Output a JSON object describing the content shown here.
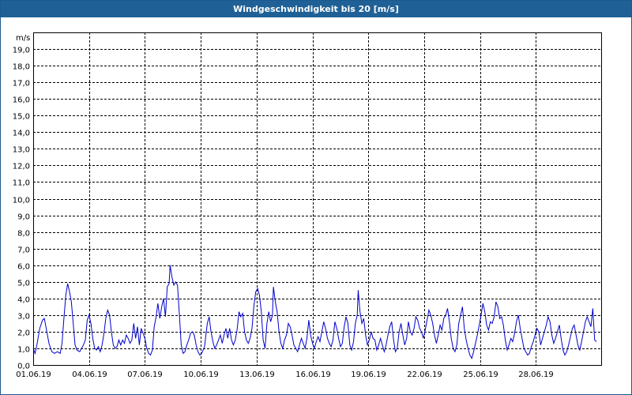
{
  "window": {
    "title": "Windgeschwindigkeit bis 20 [m/s]"
  },
  "colors": {
    "titlebar": "#1f6196",
    "series": "#0000cc",
    "grid": "#000000"
  },
  "chart_data": {
    "type": "line",
    "title": "Windgeschwindigkeit bis 20 [m/s]",
    "ylabel": "m/s",
    "xlabel": "",
    "ylim": [
      0,
      20
    ],
    "grid": true,
    "y_ticks": [
      "0,0",
      "1,0",
      "2,0",
      "3,0",
      "4,0",
      "5,0",
      "6,0",
      "7,0",
      "8,0",
      "9,0",
      "10,0",
      "11,0",
      "12,0",
      "13,0",
      "14,0",
      "15,0",
      "16,0",
      "17,0",
      "18,0",
      "19,0"
    ],
    "x_ticks": [
      "01.06.19",
      "04.06.19",
      "07.06.19",
      "10.06.19",
      "13.06.19",
      "16.06.19",
      "19.06.19",
      "22.06.19",
      "25.06.19",
      "28.06.19"
    ],
    "x_range_days": [
      0,
      30.5
    ],
    "series": [
      {
        "values": [
          [
            0.0,
            1.0
          ],
          [
            0.1,
            0.7
          ],
          [
            0.2,
            1.2
          ],
          [
            0.35,
            2.2
          ],
          [
            0.5,
            2.7
          ],
          [
            0.6,
            2.8
          ],
          [
            0.7,
            2.2
          ],
          [
            0.85,
            1.3
          ],
          [
            1.0,
            0.8
          ],
          [
            1.15,
            0.7
          ],
          [
            1.3,
            0.8
          ],
          [
            1.45,
            0.7
          ],
          [
            1.55,
            1.3
          ],
          [
            1.65,
            2.8
          ],
          [
            1.75,
            4.2
          ],
          [
            1.85,
            4.9
          ],
          [
            1.95,
            4.4
          ],
          [
            2.05,
            3.8
          ],
          [
            2.15,
            2.5
          ],
          [
            2.25,
            1.2
          ],
          [
            2.35,
            0.9
          ],
          [
            2.5,
            0.8
          ],
          [
            2.6,
            1.0
          ],
          [
            2.7,
            1.2
          ],
          [
            2.8,
            1.5
          ],
          [
            2.9,
            2.7
          ],
          [
            3.0,
            3.0
          ],
          [
            3.1,
            2.5
          ],
          [
            3.2,
            1.6
          ],
          [
            3.3,
            1.0
          ],
          [
            3.4,
            0.9
          ],
          [
            3.5,
            1.1
          ],
          [
            3.6,
            0.8
          ],
          [
            3.7,
            1.2
          ],
          [
            3.8,
            1.9
          ],
          [
            3.9,
            2.8
          ],
          [
            4.0,
            3.3
          ],
          [
            4.1,
            3.0
          ],
          [
            4.2,
            2.0
          ],
          [
            4.3,
            1.2
          ],
          [
            4.4,
            1.0
          ],
          [
            4.5,
            1.1
          ],
          [
            4.6,
            1.5
          ],
          [
            4.7,
            1.2
          ],
          [
            4.8,
            1.5
          ],
          [
            4.9,
            1.3
          ],
          [
            5.0,
            1.8
          ],
          [
            5.1,
            1.6
          ],
          [
            5.2,
            1.3
          ],
          [
            5.3,
            1.5
          ],
          [
            5.4,
            2.5
          ],
          [
            5.5,
            1.6
          ],
          [
            5.6,
            2.3
          ],
          [
            5.7,
            1.2
          ],
          [
            5.8,
            2.2
          ],
          [
            5.9,
            1.9
          ],
          [
            6.0,
            1.6
          ],
          [
            6.1,
            1.0
          ],
          [
            6.2,
            0.7
          ],
          [
            6.3,
            0.6
          ],
          [
            6.4,
            0.9
          ],
          [
            6.5,
            2.3
          ],
          [
            6.6,
            2.9
          ],
          [
            6.7,
            3.7
          ],
          [
            6.8,
            2.8
          ],
          [
            6.9,
            3.5
          ],
          [
            7.0,
            4.0
          ],
          [
            7.1,
            2.9
          ],
          [
            7.2,
            4.7
          ],
          [
            7.3,
            4.9
          ],
          [
            7.35,
            6.0
          ],
          [
            7.45,
            5.3
          ],
          [
            7.55,
            4.8
          ],
          [
            7.65,
            5.0
          ],
          [
            7.75,
            4.8
          ],
          [
            7.85,
            3.0
          ],
          [
            7.95,
            1.2
          ],
          [
            8.05,
            0.7
          ],
          [
            8.15,
            0.8
          ],
          [
            8.25,
            1.2
          ],
          [
            8.35,
            1.5
          ],
          [
            8.45,
            1.9
          ],
          [
            8.55,
            2.0
          ],
          [
            8.65,
            1.8
          ],
          [
            8.75,
            1.2
          ],
          [
            8.85,
            0.8
          ],
          [
            8.95,
            0.6
          ],
          [
            9.05,
            0.7
          ],
          [
            9.2,
            1.1
          ],
          [
            9.35,
            2.5
          ],
          [
            9.45,
            2.9
          ],
          [
            9.55,
            2.0
          ],
          [
            9.65,
            1.4
          ],
          [
            9.75,
            1.0
          ],
          [
            9.85,
            1.2
          ],
          [
            9.95,
            1.5
          ],
          [
            10.05,
            1.8
          ],
          [
            10.15,
            1.3
          ],
          [
            10.25,
            1.8
          ],
          [
            10.35,
            2.2
          ],
          [
            10.45,
            1.6
          ],
          [
            10.55,
            2.2
          ],
          [
            10.65,
            1.5
          ],
          [
            10.75,
            1.2
          ],
          [
            10.85,
            1.5
          ],
          [
            10.95,
            2.1
          ],
          [
            11.05,
            3.2
          ],
          [
            11.15,
            2.9
          ],
          [
            11.25,
            3.1
          ],
          [
            11.35,
            2.0
          ],
          [
            11.45,
            1.5
          ],
          [
            11.55,
            1.3
          ],
          [
            11.65,
            1.6
          ],
          [
            11.75,
            2.2
          ],
          [
            11.85,
            3.5
          ],
          [
            11.95,
            4.4
          ],
          [
            12.05,
            4.6
          ],
          [
            12.15,
            4.2
          ],
          [
            12.25,
            3.2
          ],
          [
            12.35,
            1.5
          ],
          [
            12.45,
            1.0
          ],
          [
            12.55,
            2.5
          ],
          [
            12.65,
            3.2
          ],
          [
            12.75,
            2.6
          ],
          [
            12.85,
            3.0
          ],
          [
            12.9,
            4.7
          ],
          [
            13.0,
            3.8
          ],
          [
            13.1,
            3.2
          ],
          [
            13.2,
            2.0
          ],
          [
            13.3,
            1.3
          ],
          [
            13.4,
            1.0
          ],
          [
            13.5,
            1.5
          ],
          [
            13.6,
            1.8
          ],
          [
            13.7,
            2.5
          ],
          [
            13.8,
            2.3
          ],
          [
            13.9,
            1.8
          ],
          [
            14.0,
            1.2
          ],
          [
            14.1,
            1.0
          ],
          [
            14.2,
            0.8
          ],
          [
            14.3,
            1.2
          ],
          [
            14.4,
            1.6
          ],
          [
            14.5,
            1.3
          ],
          [
            14.6,
            1.0
          ],
          [
            14.7,
            1.6
          ],
          [
            14.8,
            2.7
          ],
          [
            14.9,
            1.8
          ],
          [
            15.0,
            1.3
          ],
          [
            15.1,
            1.0
          ],
          [
            15.2,
            1.4
          ],
          [
            15.3,
            1.7
          ],
          [
            15.4,
            1.4
          ],
          [
            15.5,
            2.0
          ],
          [
            15.6,
            2.6
          ],
          [
            15.7,
            2.2
          ],
          [
            15.8,
            1.6
          ],
          [
            15.9,
            1.3
          ],
          [
            16.0,
            1.1
          ],
          [
            16.1,
            1.5
          ],
          [
            16.2,
            2.6
          ],
          [
            16.3,
            2.2
          ],
          [
            16.4,
            1.6
          ],
          [
            16.5,
            1.1
          ],
          [
            16.6,
            1.3
          ],
          [
            16.7,
            2.3
          ],
          [
            16.8,
            2.9
          ],
          [
            16.9,
            2.5
          ],
          [
            17.0,
            1.2
          ],
          [
            17.1,
            0.9
          ],
          [
            17.2,
            1.4
          ],
          [
            17.3,
            2.5
          ],
          [
            17.4,
            3.0
          ],
          [
            17.45,
            4.5
          ],
          [
            17.55,
            3.2
          ],
          [
            17.65,
            2.5
          ],
          [
            17.75,
            2.8
          ],
          [
            17.85,
            1.8
          ],
          [
            17.95,
            1.2
          ],
          [
            18.05,
            1.5
          ],
          [
            18.15,
            2.0
          ],
          [
            18.25,
            1.6
          ],
          [
            18.35,
            1.5
          ],
          [
            18.45,
            0.9
          ],
          [
            18.55,
            1.2
          ],
          [
            18.65,
            1.6
          ],
          [
            18.75,
            1.2
          ],
          [
            18.85,
            0.8
          ],
          [
            18.95,
            1.2
          ],
          [
            19.05,
            1.8
          ],
          [
            19.15,
            2.3
          ],
          [
            19.25,
            2.6
          ],
          [
            19.35,
            1.5
          ],
          [
            19.45,
            0.8
          ],
          [
            19.55,
            1.0
          ],
          [
            19.65,
            2.0
          ],
          [
            19.75,
            2.5
          ],
          [
            19.85,
            1.8
          ],
          [
            19.95,
            1.2
          ],
          [
            20.05,
            1.6
          ],
          [
            20.15,
            2.6
          ],
          [
            20.25,
            2.0
          ],
          [
            20.35,
            1.8
          ],
          [
            20.45,
            2.2
          ],
          [
            20.55,
            2.9
          ],
          [
            20.65,
            2.7
          ],
          [
            20.75,
            2.2
          ],
          [
            20.85,
            2.0
          ],
          [
            20.95,
            1.6
          ],
          [
            21.05,
            2.1
          ],
          [
            21.15,
            2.7
          ],
          [
            21.25,
            3.3
          ],
          [
            21.35,
            3.0
          ],
          [
            21.45,
            2.5
          ],
          [
            21.55,
            1.8
          ],
          [
            21.65,
            1.3
          ],
          [
            21.75,
            1.8
          ],
          [
            21.85,
            2.4
          ],
          [
            21.95,
            2.1
          ],
          [
            22.05,
            2.8
          ],
          [
            22.15,
            3.0
          ],
          [
            22.25,
            3.4
          ],
          [
            22.35,
            2.6
          ],
          [
            22.45,
            1.6
          ],
          [
            22.55,
            1.0
          ],
          [
            22.65,
            0.8
          ],
          [
            22.75,
            1.2
          ],
          [
            22.85,
            2.5
          ],
          [
            22.95,
            3.0
          ],
          [
            23.05,
            3.5
          ],
          [
            23.15,
            2.2
          ],
          [
            23.25,
            1.5
          ],
          [
            23.35,
            1.0
          ],
          [
            23.45,
            0.6
          ],
          [
            23.55,
            0.4
          ],
          [
            23.65,
            0.8
          ],
          [
            23.75,
            1.3
          ],
          [
            23.85,
            1.8
          ],
          [
            23.95,
            2.4
          ],
          [
            24.05,
            3.0
          ],
          [
            24.15,
            3.7
          ],
          [
            24.25,
            3.2
          ],
          [
            24.35,
            2.4
          ],
          [
            24.45,
            2.1
          ],
          [
            24.55,
            2.6
          ],
          [
            24.65,
            2.5
          ],
          [
            24.75,
            2.9
          ],
          [
            24.85,
            3.8
          ],
          [
            24.95,
            3.5
          ],
          [
            25.05,
            2.8
          ],
          [
            25.15,
            2.9
          ],
          [
            25.25,
            2.4
          ],
          [
            25.35,
            1.5
          ],
          [
            25.45,
            0.9
          ],
          [
            25.55,
            1.2
          ],
          [
            25.65,
            1.6
          ],
          [
            25.75,
            1.4
          ],
          [
            25.85,
            1.9
          ],
          [
            25.95,
            2.6
          ],
          [
            26.05,
            3.0
          ],
          [
            26.15,
            2.2
          ],
          [
            26.25,
            1.6
          ],
          [
            26.35,
            1.0
          ],
          [
            26.45,
            0.8
          ],
          [
            26.55,
            0.6
          ],
          [
            26.65,
            0.7
          ],
          [
            26.75,
            1.1
          ],
          [
            26.85,
            1.4
          ],
          [
            26.95,
            1.8
          ],
          [
            27.05,
            2.2
          ],
          [
            27.15,
            2.0
          ],
          [
            27.25,
            1.2
          ],
          [
            27.35,
            1.6
          ],
          [
            27.45,
            2.0
          ],
          [
            27.55,
            2.4
          ],
          [
            27.65,
            2.9
          ],
          [
            27.75,
            2.6
          ],
          [
            27.85,
            1.8
          ],
          [
            27.95,
            1.3
          ],
          [
            28.05,
            1.6
          ],
          [
            28.15,
            2.0
          ],
          [
            28.25,
            2.4
          ],
          [
            28.35,
            1.6
          ],
          [
            28.45,
            0.9
          ],
          [
            28.55,
            0.6
          ],
          [
            28.65,
            0.8
          ],
          [
            28.75,
            1.2
          ],
          [
            28.85,
            1.7
          ],
          [
            28.95,
            2.2
          ],
          [
            29.05,
            2.4
          ],
          [
            29.15,
            1.8
          ],
          [
            29.25,
            1.2
          ],
          [
            29.35,
            0.9
          ],
          [
            29.45,
            1.4
          ],
          [
            29.55,
            2.0
          ],
          [
            29.65,
            2.6
          ],
          [
            29.75,
            2.9
          ],
          [
            29.85,
            2.6
          ],
          [
            29.95,
            2.3
          ],
          [
            30.05,
            3.4
          ],
          [
            30.15,
            1.5
          ],
          [
            30.25,
            1.4
          ]
        ]
      }
    ]
  }
}
